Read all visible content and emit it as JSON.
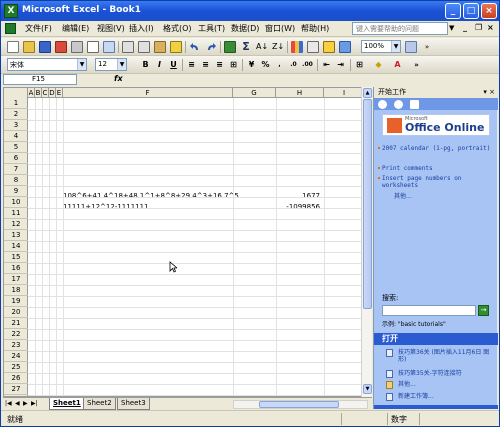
{
  "window": {
    "title": "Microsoft Excel - Book1",
    "app_icon_letter": "X"
  },
  "menu": {
    "items": [
      "文件(F)",
      "编辑(E)",
      "视图(V)",
      "插入(I)",
      "格式(O)",
      "工具(T)",
      "数据(D)",
      "窗口(W)",
      "帮助(H)"
    ],
    "help_placeholder": "键入需要帮助的问题"
  },
  "toolbar": {
    "zoom": "100%",
    "font_name": "宋体",
    "font_size": "12"
  },
  "formula_bar": {
    "name_box": "F15",
    "fx_label": "fx"
  },
  "sheet": {
    "columns": [
      "A",
      "B",
      "C",
      "D",
      "E",
      "F",
      "G",
      "H",
      "I"
    ],
    "rows": [
      "1",
      "2",
      "3",
      "4",
      "5",
      "6",
      "7",
      "8",
      "9",
      "10",
      "11",
      "12",
      "13",
      "14",
      "15",
      "16",
      "17",
      "18",
      "19",
      "20",
      "21",
      "22",
      "23",
      "24",
      "25",
      "26",
      "27"
    ],
    "cells": {
      "F9": "108^6+41.4^18+48.1^1+8^8+29.4^3+16.7^5",
      "H9": "1677",
      "F10": "11111+12^12-1111111",
      "H10": "-1099856"
    },
    "tabs": [
      "Sheet1",
      "Sheet2",
      "Sheet3"
    ],
    "active_tab": "Sheet1"
  },
  "status": {
    "ready": "就绪",
    "mode": "数字"
  },
  "task_pane": {
    "title": "开始工作",
    "close": "▾ ×",
    "logo_small": "Microsoft",
    "logo_text": "Office Online",
    "links": [
      "2007 calendar (1-pg, portrait)",
      "Print comments",
      "Insert page numbers on worksheets"
    ],
    "more": "其他...",
    "search_label": "搜索:",
    "go": "→",
    "example": "示例: \"basic tutorials\"",
    "open_header": "打开",
    "files": [
      "技巧第36关 (图片插入11月6日 图形)",
      "技巧第35关-字符连接符"
    ],
    "more_files": "其他...",
    "new_workbook": "新建工作簿..."
  }
}
